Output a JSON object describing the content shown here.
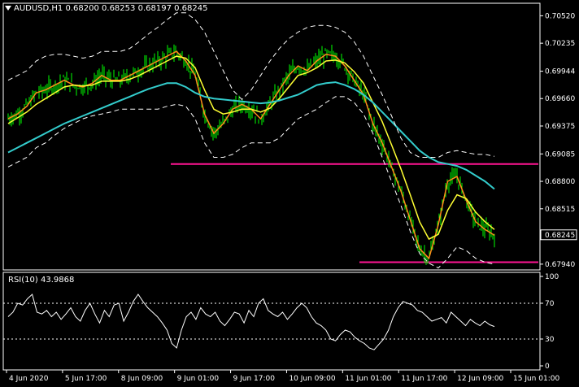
{
  "header": {
    "symbol": "AUDUSD,H1",
    "open": "0.68200",
    "high": "0.68253",
    "low": "0.68197",
    "close": "0.68245"
  },
  "rsi_header": {
    "label": "RSI(10)",
    "value": "43.9868"
  },
  "colors": {
    "background": "#000000",
    "grid_frame": "#ffffff",
    "candles": "#00ff00",
    "ma_fast": "#ff8c1a",
    "ma_slow": "#ffff33",
    "ma_long": "#33cccc",
    "bands": "#ffffff",
    "support_lines": "#ff1493",
    "rsi_line": "#ffffff",
    "current_price_box": "#000000"
  },
  "chart_data": [
    {
      "type": "line",
      "title": "AUDUSD,H1",
      "y_ticks": [
        "0.70520",
        "0.70235",
        "0.69944",
        "0.69660",
        "0.69375",
        "0.69085",
        "0.68800",
        "0.68515",
        "0.68245",
        "0.67940"
      ],
      "ylim": [
        0.6788,
        0.7065
      ],
      "current_price": "0.68245",
      "x_ticks": [
        "4 Jun 2020",
        "5 Jun 17:00",
        "8 Jun 09:00",
        "9 Jun 01:00",
        "9 Jun 17:00",
        "10 Jun 09:00",
        "11 Jun 01:00",
        "11 Jun 17:00",
        "12 Jun 09:00",
        "15 Jun 01:00"
      ],
      "horizontal_levels": [
        0.6898,
        0.6796
      ],
      "series": [
        {
          "values": [
            0.6945,
            0.695,
            0.6958,
            0.6972,
            0.6975,
            0.698,
            0.6985,
            0.698,
            0.6978,
            0.6982,
            0.699,
            0.6985,
            0.6985,
            0.699,
            0.6995,
            0.7,
            0.7005,
            0.701,
            0.7015,
            0.7005,
            0.699,
            0.695,
            0.693,
            0.694,
            0.6955,
            0.696,
            0.6955,
            0.6945,
            0.696,
            0.6975,
            0.699,
            0.7,
            0.6995,
            0.7005,
            0.7012,
            0.701,
            0.7,
            0.6985,
            0.697,
            0.694,
            0.692,
            0.6895,
            0.687,
            0.684,
            0.681,
            0.68,
            0.6835,
            0.688,
            0.6885,
            0.686,
            0.6838,
            0.683,
            0.6824
          ]
        },
        {
          "values": [
            0.694,
            0.6946,
            0.6952,
            0.696,
            0.6966,
            0.6972,
            0.6978,
            0.698,
            0.6979,
            0.698,
            0.6984,
            0.6984,
            0.6984,
            0.6986,
            0.699,
            0.6995,
            0.7,
            0.7005,
            0.701,
            0.7008,
            0.6998,
            0.6975,
            0.6955,
            0.695,
            0.6952,
            0.6955,
            0.6955,
            0.6952,
            0.6956,
            0.6966,
            0.6978,
            0.699,
            0.6993,
            0.6998,
            0.7005,
            0.7006,
            0.7003,
            0.6994,
            0.6982,
            0.6962,
            0.6942,
            0.6918,
            0.6893,
            0.6866,
            0.6838,
            0.682,
            0.6825,
            0.685,
            0.6866,
            0.6862,
            0.6848,
            0.6838,
            0.683
          ]
        },
        {
          "values": [
            0.691,
            0.6915,
            0.692,
            0.6925,
            0.693,
            0.6935,
            0.694,
            0.6944,
            0.6948,
            0.6952,
            0.6956,
            0.696,
            0.6964,
            0.6968,
            0.6972,
            0.6976,
            0.6979,
            0.6982,
            0.6982,
            0.6978,
            0.6972,
            0.6968,
            0.6966,
            0.6965,
            0.6964,
            0.6963,
            0.6962,
            0.6961,
            0.6962,
            0.6964,
            0.6967,
            0.697,
            0.6975,
            0.698,
            0.6982,
            0.6983,
            0.698,
            0.6976,
            0.697,
            0.6962,
            0.6952,
            0.6942,
            0.6932,
            0.6922,
            0.6912,
            0.6905,
            0.69,
            0.6898,
            0.6896,
            0.6892,
            0.6886,
            0.688,
            0.6872
          ]
        },
        {
          "values": [
            0.6985,
            0.699,
            0.6995,
            0.7005,
            0.701,
            0.7012,
            0.7012,
            0.701,
            0.7008,
            0.701,
            0.7015,
            0.7015,
            0.7015,
            0.7018,
            0.7025,
            0.7033,
            0.704,
            0.7048,
            0.7055,
            0.7055,
            0.7048,
            0.7035,
            0.7015,
            0.6995,
            0.6975,
            0.6965,
            0.6975,
            0.699,
            0.7005,
            0.7018,
            0.7028,
            0.7035,
            0.704,
            0.7042,
            0.7042,
            0.704,
            0.7035,
            0.7025,
            0.701,
            0.699,
            0.697,
            0.6948,
            0.6925,
            0.691,
            0.6905,
            0.6905,
            0.6905,
            0.691,
            0.6912,
            0.691,
            0.6908,
            0.6908,
            0.6906
          ]
        },
        {
          "values": [
            0.6895,
            0.69,
            0.6905,
            0.6915,
            0.692,
            0.6928,
            0.6935,
            0.694,
            0.6945,
            0.6948,
            0.695,
            0.6952,
            0.6955,
            0.6955,
            0.6955,
            0.6955,
            0.6955,
            0.6958,
            0.696,
            0.6958,
            0.6945,
            0.692,
            0.6905,
            0.6905,
            0.6908,
            0.6915,
            0.692,
            0.692,
            0.692,
            0.6925,
            0.6935,
            0.6945,
            0.695,
            0.6955,
            0.6962,
            0.6968,
            0.6968,
            0.6962,
            0.695,
            0.693,
            0.6905,
            0.688,
            0.6855,
            0.6828,
            0.6805,
            0.6795,
            0.679,
            0.68,
            0.6812,
            0.6808,
            0.68,
            0.6796,
            0.6794
          ]
        }
      ]
    },
    {
      "type": "line",
      "title": "RSI(10) 43.9868",
      "y_ticks": [
        "100",
        "70",
        "30",
        "0"
      ],
      "ylim": [
        0,
        100
      ],
      "levels": [
        70,
        30
      ],
      "series": [
        {
          "values": [
            55,
            60,
            70,
            68,
            75,
            80,
            60,
            58,
            62,
            55,
            60,
            52,
            58,
            65,
            55,
            50,
            62,
            70,
            58,
            48,
            62,
            55,
            68,
            70,
            50,
            60,
            72,
            80,
            72,
            65,
            60,
            55,
            48,
            40,
            25,
            20,
            40,
            55,
            60,
            52,
            65,
            58,
            55,
            60,
            50,
            45,
            52,
            60,
            58,
            48,
            62,
            55,
            70,
            75,
            62,
            58,
            55,
            60,
            52,
            58,
            65,
            70,
            65,
            55,
            48,
            45,
            40,
            30,
            28,
            35,
            40,
            38,
            32,
            28,
            25,
            20,
            18,
            24,
            30,
            40,
            55,
            65,
            72,
            70,
            68,
            62,
            60,
            55,
            50,
            52,
            54,
            48,
            60,
            55,
            50,
            45,
            52,
            48,
            45,
            50,
            46,
            44
          ]
        }
      ]
    }
  ]
}
